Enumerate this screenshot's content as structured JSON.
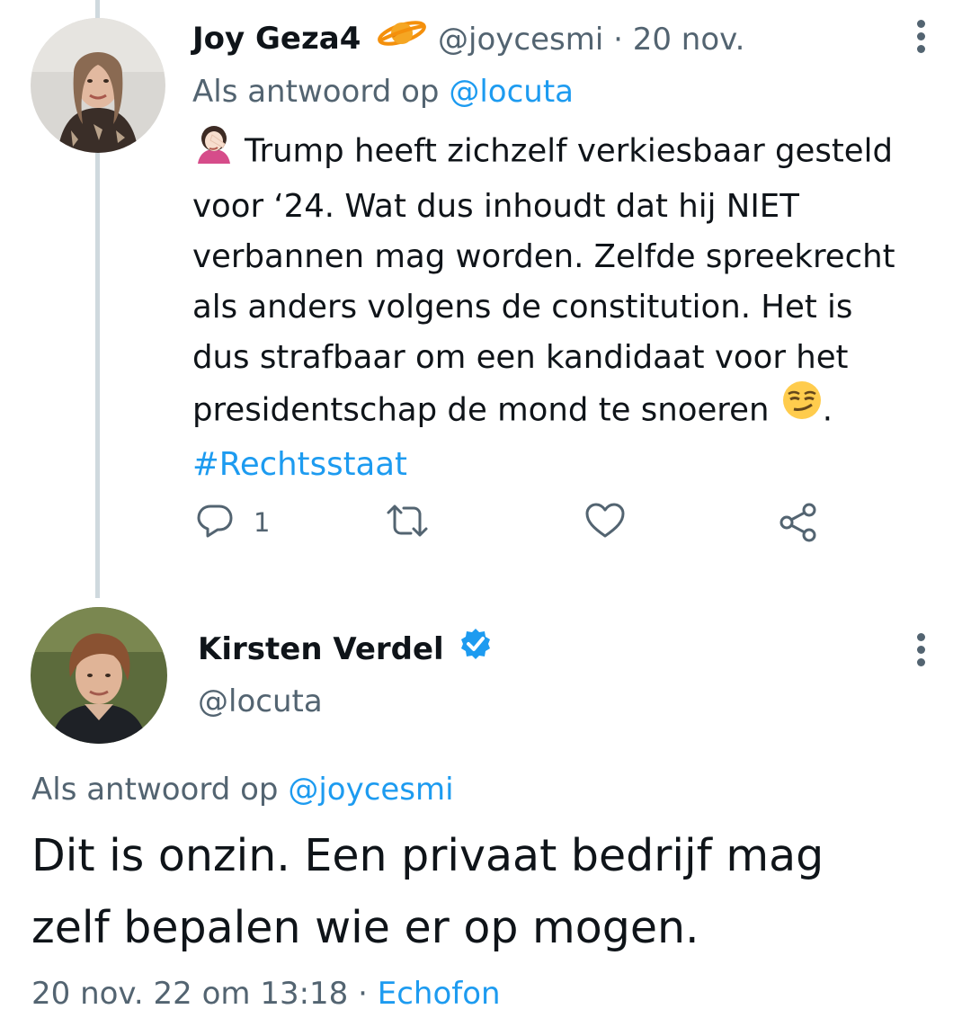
{
  "tweet1": {
    "display_name": "Joy Geza4",
    "name_emoji": "ringed-planet-emoji",
    "handle": "@joycesmi",
    "separator": "·",
    "date": "20 nov.",
    "reply_prefix": "Als antwoord op",
    "reply_to": "@locuta",
    "lead_emoji": "woman-facepalming-emoji",
    "lines": [
      "Trump heeft zichzelf verkiesbaar gesteld",
      "voor ‘24. Wat dus inhoudt dat hij NIET",
      "verbannen mag worden. Zelfde spreekrecht",
      "als anders volgens de constitution. Het is",
      "dus strafbaar om een kandidaat voor het",
      "presidentschap de mond te snoeren"
    ],
    "trail_emoji": "smirking-face-emoji",
    "trail_text": ".",
    "hashtag": "#Rechtsstaat",
    "actions": {
      "reply_count": "1",
      "icons": [
        "reply-icon",
        "retweet-icon",
        "like-icon",
        "share-icon"
      ]
    }
  },
  "tweet2": {
    "display_name": "Kirsten Verdel",
    "verified_icon": "verified-badge-icon",
    "handle": "@locuta",
    "reply_prefix": "Als antwoord op",
    "reply_to": "@joycesmi",
    "lines": [
      "Dit is onzin. Een privaat bedrijf mag",
      "zelf bepalen wie er op mogen."
    ],
    "timestamp": "20 nov. 22 om 13:18",
    "separator": "·",
    "source": "Echofon"
  },
  "colors": {
    "link": "#1d9bf0",
    "muted": "#536471",
    "text": "#0f1419",
    "thread_line": "#cfd9de"
  }
}
